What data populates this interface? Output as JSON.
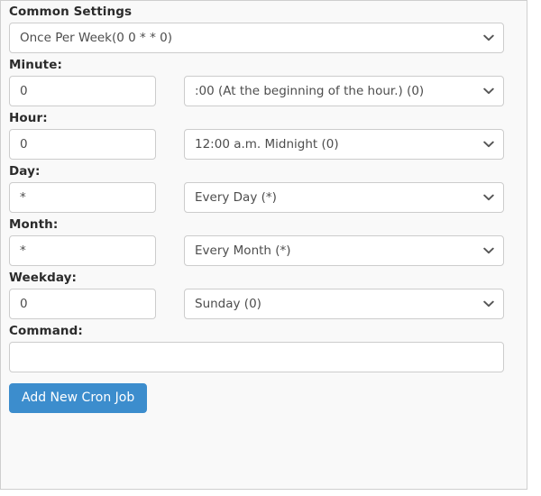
{
  "panel": {
    "name": "cron-job-editor"
  },
  "common_settings": {
    "label": "Common Settings",
    "value": "Once Per Week(0 0 * * 0)"
  },
  "fields": [
    {
      "key": "minute",
      "label": "Minute:",
      "value": "0",
      "placeholder": "",
      "select_value": ":00 (At the beginning of the hour.) (0)"
    },
    {
      "key": "hour",
      "label": "Hour:",
      "value": "0",
      "placeholder": "",
      "select_value": "12:00 a.m. Midnight (0)"
    },
    {
      "key": "day",
      "label": "Day:",
      "value": "*",
      "placeholder": "",
      "select_value": "Every Day (*)"
    },
    {
      "key": "month",
      "label": "Month:",
      "value": "*",
      "placeholder": "",
      "select_value": "Every Month (*)"
    },
    {
      "key": "weekday",
      "label": "Weekday:",
      "value": "0",
      "placeholder": "",
      "select_value": "Sunday (0)"
    }
  ],
  "command": {
    "label": "Command:",
    "value": "",
    "placeholder": ""
  },
  "submit": {
    "label": "Add New Cron Job"
  },
  "icons": {
    "chevron_down": "chevron-down-icon"
  },
  "colors": {
    "primary": "#3c8dcd",
    "panel_bg": "#f9f9f9",
    "border": "#cccccc",
    "label_text": "#2b2b2b",
    "value_text": "#4d4d4d"
  }
}
